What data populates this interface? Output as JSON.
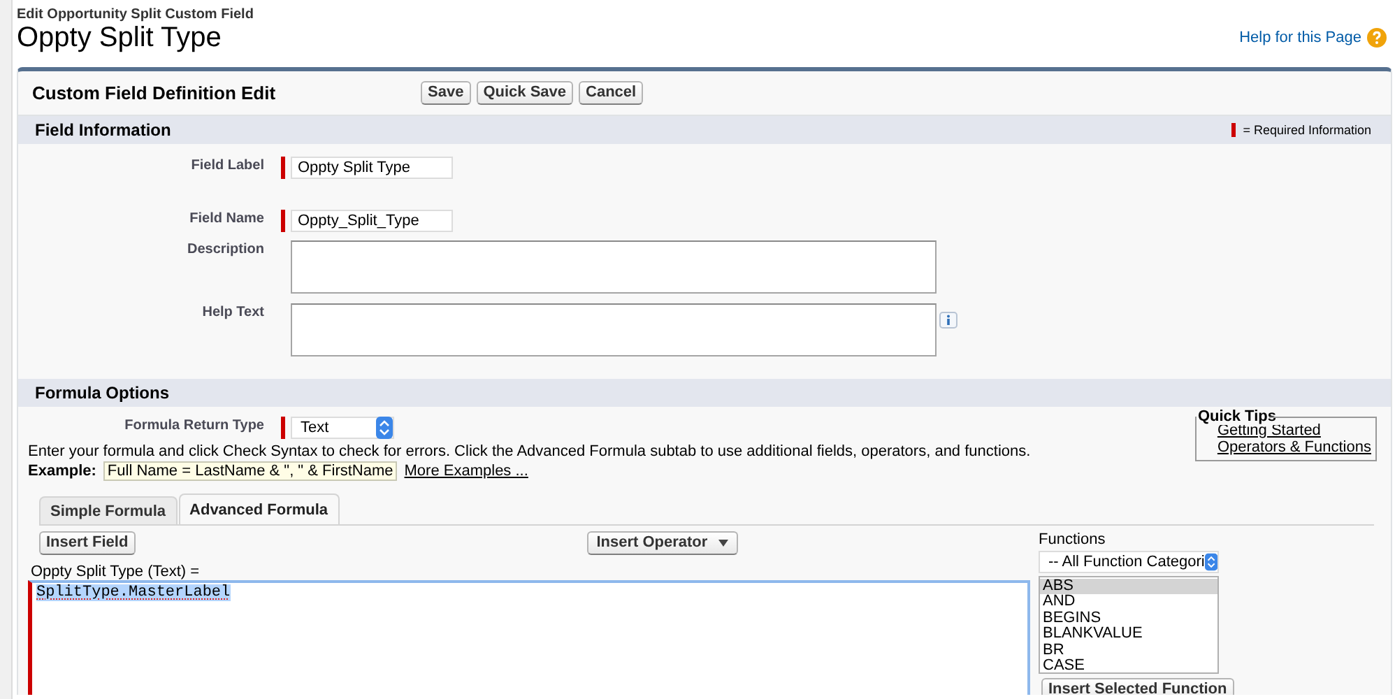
{
  "header": {
    "subtitle": "Edit Opportunity Split Custom Field",
    "title": "Oppty Split Type",
    "help_link": "Help for this Page"
  },
  "panel": {
    "title": "Custom Field Definition Edit",
    "buttons": [
      "Save",
      "Quick Save",
      "Cancel"
    ]
  },
  "field_information": {
    "title": "Field Information",
    "legend": "= Required Information",
    "fields": [
      {
        "label": "Field Label",
        "kind": "input",
        "value": "Oppty Split Type",
        "required": true,
        "info": false
      },
      {
        "label": "Field Name",
        "kind": "input",
        "value": "Oppty_Split_Type",
        "required": true,
        "info": false
      },
      {
        "label": "Description",
        "kind": "textarea",
        "required": false,
        "info": false
      },
      {
        "label": "Help Text",
        "kind": "textarea",
        "required": false,
        "info": true
      }
    ]
  },
  "formula_options": {
    "title": "Formula Options",
    "return_type": {
      "label": "Formula Return Type",
      "value": "Text",
      "required": true
    },
    "instructions": "Enter your formula and click Check Syntax to check for errors. Click the Advanced Formula subtab to use additional fields, operators, and functions.",
    "example_label": "Example:",
    "example": "Full Name = LastName & \", \" & FirstName",
    "more_examples": "More Examples ...",
    "quick_tips": {
      "title": "Quick Tips",
      "links": [
        "Getting Started",
        "Operators & Functions"
      ]
    },
    "tabs": [
      {
        "label": "Simple Formula",
        "selected": false
      },
      {
        "label": "Advanced Formula",
        "selected": true
      }
    ],
    "insert_field": "Insert Field",
    "insert_operator": "Insert Operator",
    "editor_label": "Oppty Split Type (Text) =",
    "formula": "SplitType.MasterLabel",
    "formula_required": true,
    "functions": {
      "label": "Functions",
      "category": "-- All Function Categori",
      "insert_button": "Insert Selected Function",
      "items": [
        {
          "label": "ABS",
          "selected": true
        },
        {
          "label": "AND",
          "selected": false
        },
        {
          "label": "BEGINS",
          "selected": false
        },
        {
          "label": "BLANKVALUE",
          "selected": false
        },
        {
          "label": "BR",
          "selected": false
        },
        {
          "label": "CASE",
          "selected": false
        }
      ]
    }
  }
}
